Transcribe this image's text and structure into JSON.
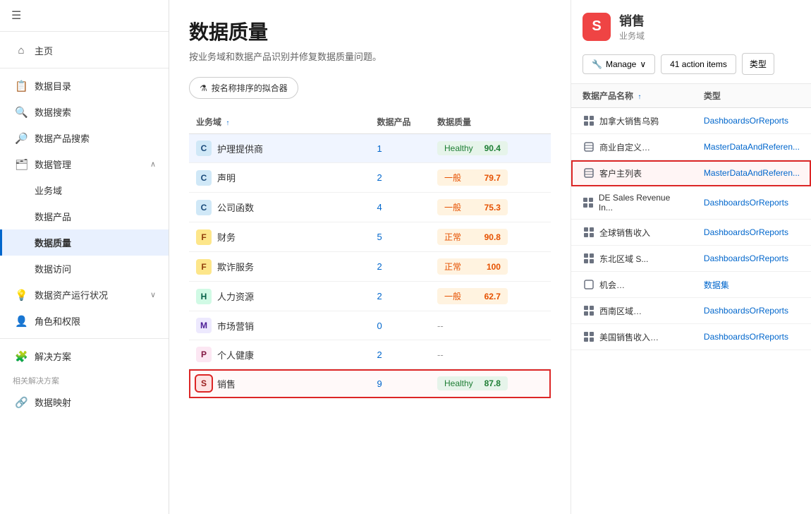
{
  "app": {
    "title": "数据质量"
  },
  "sidebar": {
    "hamburger": "☰",
    "items": [
      {
        "id": "home",
        "label": "主页",
        "icon": "⌂",
        "active": false,
        "indent": 0
      },
      {
        "id": "data-catalog",
        "label": "数据目录",
        "icon": "📋",
        "active": false,
        "indent": 0
      },
      {
        "id": "data-search",
        "label": "数据搜索",
        "icon": "🔍",
        "active": false,
        "indent": 0
      },
      {
        "id": "data-product-search",
        "label": "数据产品搜索",
        "icon": "🔎",
        "active": false,
        "indent": 0
      },
      {
        "id": "data-management",
        "label": "数据管理",
        "icon": "🗂",
        "active": false,
        "indent": 0,
        "expandable": true,
        "expanded": true
      },
      {
        "id": "business-domain",
        "label": "业务域",
        "icon": "",
        "active": false,
        "indent": 1
      },
      {
        "id": "data-product",
        "label": "数据产品",
        "icon": "",
        "active": false,
        "indent": 1
      },
      {
        "id": "data-quality",
        "label": "数据质量",
        "icon": "",
        "active": true,
        "indent": 1
      },
      {
        "id": "data-access",
        "label": "数据访问",
        "icon": "",
        "active": false,
        "indent": 1
      },
      {
        "id": "data-assets",
        "label": "数据资产运行状况",
        "icon": "💡",
        "active": false,
        "indent": 0,
        "expandable": true
      },
      {
        "id": "roles",
        "label": "角色和权限",
        "icon": "👤",
        "active": false,
        "indent": 0
      },
      {
        "id": "divider1",
        "type": "divider"
      },
      {
        "id": "solutions",
        "label": "解决方案",
        "icon": "🧩",
        "active": false,
        "indent": 0
      },
      {
        "id": "related-solutions",
        "label": "相关解决方案",
        "section": true
      },
      {
        "id": "data-mapping",
        "label": "数据映射",
        "icon": "🔗",
        "active": false,
        "indent": 0
      }
    ]
  },
  "page": {
    "title": "数据质量",
    "subtitle": "按业务域和数据产品识别并修复数据质量问题。",
    "filter_label": "按名称排序的拟合器",
    "table_headers": {
      "domain": "业务域",
      "products": "数据产品",
      "quality": "数据质量"
    },
    "rows": [
      {
        "id": "manage-provider",
        "badge": "C",
        "name": "护理提供商",
        "products": "1",
        "quality_label": "Healthy",
        "quality_score": "90.4",
        "quality_type": "healthy",
        "selected": true
      },
      {
        "id": "statement",
        "badge": "C",
        "name": "声明",
        "products": "2",
        "quality_label": "一般",
        "quality_score": "79.7",
        "quality_type": "fair"
      },
      {
        "id": "company-function",
        "badge": "C",
        "name": "公司函数",
        "products": "4",
        "quality_label": "一般",
        "quality_score": "75.3",
        "quality_type": "fair"
      },
      {
        "id": "finance",
        "badge": "F",
        "name": "财务",
        "products": "5",
        "quality_label": "正常",
        "quality_score": "90.8",
        "quality_type": "normal"
      },
      {
        "id": "fraud-service",
        "badge": "F",
        "name": "欺诈服务",
        "products": "2",
        "quality_label": "正常",
        "quality_score": "100",
        "quality_type": "normal"
      },
      {
        "id": "hr",
        "badge": "H",
        "name": "人力资源",
        "products": "2",
        "quality_label": "一般",
        "quality_score": "62.7",
        "quality_type": "fair"
      },
      {
        "id": "marketing",
        "badge": "M",
        "name": "市场营销",
        "products": "0",
        "quality_label": "--",
        "quality_score": "",
        "quality_type": "dash"
      },
      {
        "id": "personal-health",
        "badge": "P",
        "name": "个人健康",
        "products": "2",
        "quality_label": "--",
        "quality_score": "",
        "quality_type": "dash"
      },
      {
        "id": "sales",
        "badge": "S",
        "name": "销售",
        "products": "9",
        "quality_label": "Healthy",
        "quality_score": "87.8",
        "quality_type": "healthy",
        "highlighted": true
      }
    ]
  },
  "right_panel": {
    "domain_letter": "S",
    "domain_name": "销售",
    "domain_type": "业务域",
    "manage_label": "Manage",
    "action_items_label": "41 action items",
    "type_label": "类型",
    "table_headers": {
      "product_name": "数据产品名称",
      "type": "类型"
    },
    "products": [
      {
        "id": "canada-sales-bird",
        "name": "加拿大销售乌鸦",
        "type": "DashboardsOrReports",
        "icon": "dashboard"
      },
      {
        "id": "business-custom",
        "name": "商业自定义…",
        "type": "MasterDataAndReferen...",
        "icon": "master"
      },
      {
        "id": "customer-list",
        "name": "客户主列表",
        "type": "MasterDataAndReferen...",
        "icon": "master",
        "highlighted": true
      },
      {
        "id": "de-sales-revenue",
        "name": "DE Sales Revenue In...",
        "type": "DashboardsOrReports",
        "icon": "dashboard"
      },
      {
        "id": "global-sales-revenue",
        "name": "全球销售收入",
        "type": "DashboardsOrReports",
        "icon": "dashboard"
      },
      {
        "id": "northeast-region",
        "name": "东北区域 S...",
        "type": "DashboardsOrReports",
        "icon": "dashboard"
      },
      {
        "id": "opportunity",
        "name": "机会…",
        "type": "数据集",
        "icon": "dataset"
      },
      {
        "id": "southwest-region",
        "name": "西南区域…",
        "type": "DashboardsOrReports",
        "icon": "dashboard"
      },
      {
        "id": "us-sales-revenue",
        "name": "美国销售收入…",
        "type": "DashboardsOrReports",
        "icon": "dashboard"
      }
    ]
  }
}
